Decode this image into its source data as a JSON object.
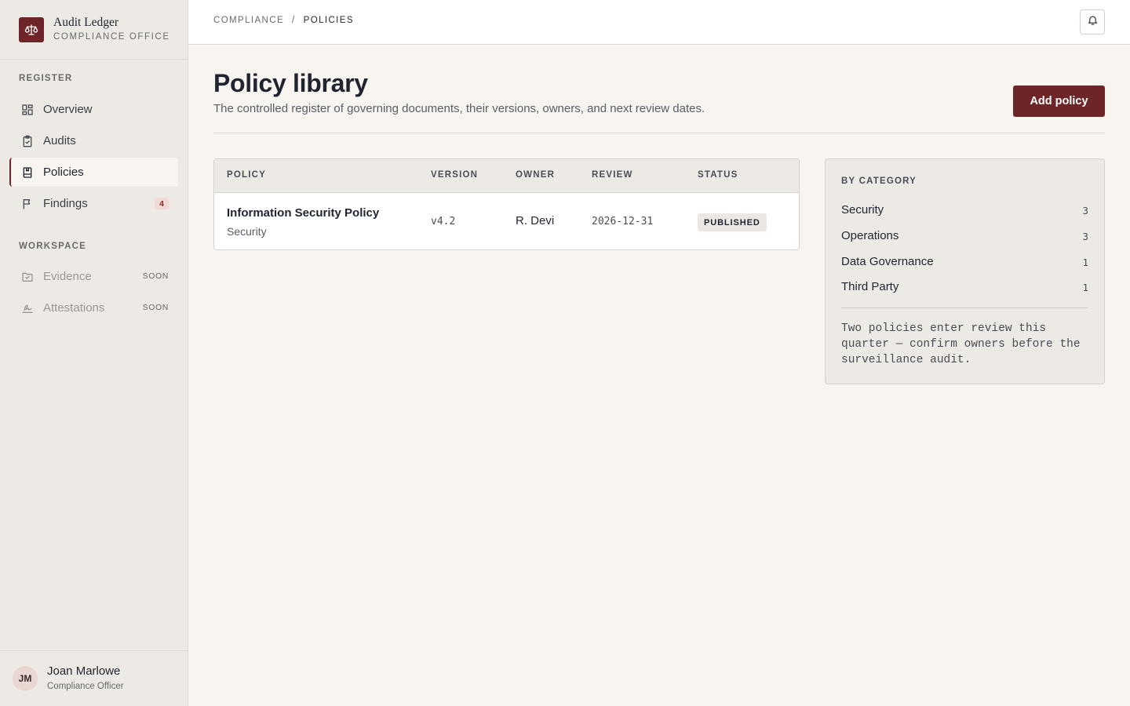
{
  "brand": {
    "name": "Audit Ledger",
    "subtitle": "COMPLIANCE OFFICE",
    "logo_icon": "scales-icon",
    "accent_color": "#6e2527"
  },
  "sidebar": {
    "register_label": "REGISTER",
    "workspace_label": "WORKSPACE",
    "items": [
      {
        "label": "Overview",
        "icon": "grid-icon",
        "active": false
      },
      {
        "label": "Audits",
        "icon": "clipboard-check-icon",
        "active": false
      },
      {
        "label": "Policies",
        "icon": "book-icon",
        "active": true
      },
      {
        "label": "Findings",
        "icon": "flag-icon",
        "active": false,
        "badge": "4"
      }
    ],
    "workspace_items": [
      {
        "label": "Evidence",
        "icon": "folder-check-icon",
        "tag": "SOON"
      },
      {
        "label": "Attestations",
        "icon": "signature-icon",
        "tag": "SOON"
      }
    ]
  },
  "user": {
    "initials": "JM",
    "name": "Joan Marlowe",
    "role": "Compliance Officer"
  },
  "topbar": {
    "breadcrumb": [
      "COMPLIANCE",
      "/",
      "POLICIES"
    ],
    "bell_icon": "bell-icon"
  },
  "page": {
    "title": "Policy library",
    "description": "The controlled register of governing documents, their versions, owners, and next review dates.",
    "add_button": "Add policy"
  },
  "table": {
    "columns": [
      "POLICY",
      "VERSION",
      "OWNER",
      "REVIEW",
      "STATUS"
    ],
    "rows": [
      {
        "title": "Information Security Policy",
        "category": "Security",
        "version": "v4.2",
        "owner": "R. Devi",
        "review": "2026-12-31",
        "status": "PUBLISHED"
      }
    ]
  },
  "categories": {
    "title": "BY CATEGORY",
    "items": [
      {
        "name": "Security",
        "count": "3"
      },
      {
        "name": "Operations",
        "count": "3"
      },
      {
        "name": "Data Governance",
        "count": "1"
      },
      {
        "name": "Third Party",
        "count": "1"
      }
    ],
    "note": "Two policies enter review this quarter — confirm owners before the surveillance audit."
  }
}
